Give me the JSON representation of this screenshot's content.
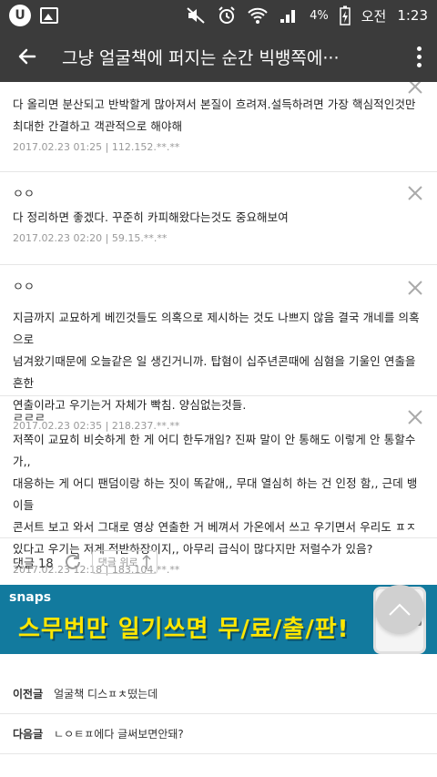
{
  "status_bar": {
    "app_icon_letter": "U",
    "battery_percent": "4%",
    "ampm": "오전",
    "time": "1:23"
  },
  "app_bar": {
    "title": "그냥 얼굴책에 퍼지는 순간 빅뱅쪽에···"
  },
  "comments": [
    {
      "name": "",
      "lines": [
        "다 올리면 분산되고 반박할게 많아져서 본질이 흐려져.설득하려면 가장 핵심적인것만",
        "최대한 간결하고 객관적으로 해야해"
      ],
      "date": "2017.02.23 01:25",
      "ip": "112.152.**.**"
    },
    {
      "name": "ㅇㅇ",
      "lines": [
        "다 정리하면 좋겠다. 꾸준히 카피해왔다는것도 중요해보여"
      ],
      "date": "2017.02.23 02:20",
      "ip": "59.15.**.**"
    },
    {
      "name": "ㅇㅇ",
      "lines": [
        "지금까지 교묘하게 베낀것들도 의혹으로 제시하는 것도 나쁘지 않음 결국 개네를 의혹으로",
        "넘겨왔기때문에 오늘같은 일 생긴거니까. 탑혐이 십주년콘때에 심혐을 기울인 연출을 흔한",
        "연출이라고 우기는거 자체가 빡침. 양심없는것들."
      ],
      "date": "2017.02.23 02:35",
      "ip": "218.237.**.**"
    },
    {
      "name": "ㄹㄹㄹ",
      "lines": [
        "저쪽이 교묘히 비슷하게 한 게 어디 한두개임? 진짜 말이 안 통해도 이렇게 안 통할수가,,",
        "대응하는 게 어디 팬덤이랑 하는 짓이 똑같애,, 무대 열심히 하는 건 인정 함,, 근데 뱅이들",
        "콘서트 보고 와서 그대로 영상 연출한 거 베껴서 가온에서 쓰고 우기면서 우리도 ㅍㅈ",
        "있다고 우기는 저게 적반하장이지,, 아무리 급식이 많다지만 저럴수가 있음?"
      ],
      "date": "2017.02.23 12:18",
      "ip": "183.104.**.**"
    }
  ],
  "comment_count": {
    "label": "댓글 18",
    "up_label": "댓글 위로"
  },
  "ad": {
    "logo": "snaps",
    "text": "스무번만 일기쓰면 무/료/출/판!"
  },
  "nav": {
    "prev_label": "이전글",
    "prev_text": "얼굴책 디스ㅍㅊ떴는데",
    "next_label": "다음글",
    "next_text": "ㄴㅇㅌㅍ에다 글써보면안돼?"
  }
}
